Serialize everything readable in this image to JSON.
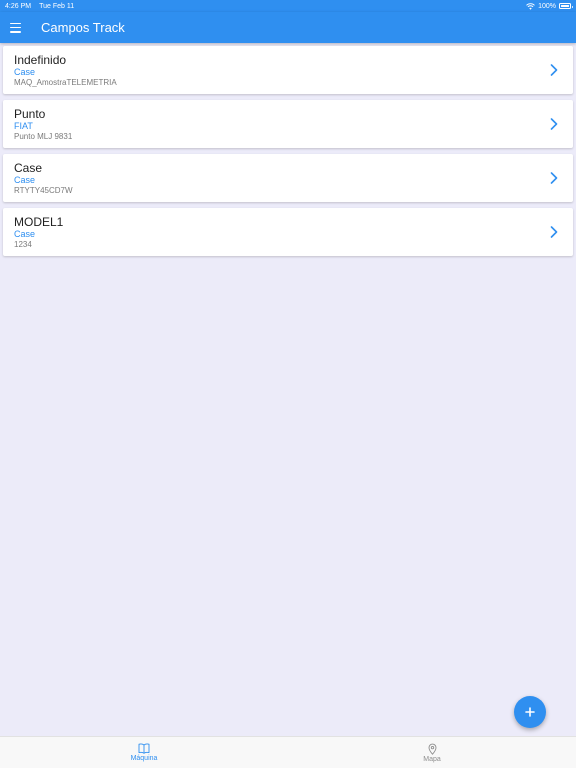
{
  "status_bar": {
    "time": "4:26 PM",
    "date": "Tue Feb 11",
    "battery": "100%",
    "icons": [
      "wifi-icon",
      "battery-icon"
    ]
  },
  "app_bar": {
    "title": "Campos Track",
    "menu_icon": "hamburger-menu-icon"
  },
  "machines": [
    {
      "name": "Indefinido",
      "brand": "Case",
      "model": "MAQ_AmostraTELEMETRIA"
    },
    {
      "name": "Punto",
      "brand": "FIAT",
      "model": "Punto MLJ 9831"
    },
    {
      "name": "Case",
      "brand": "Case",
      "model": "RTYTY45CD7W"
    },
    {
      "name": "MODEL1",
      "brand": "Case",
      "model": "1234"
    }
  ],
  "fab": {
    "icon": "plus-icon",
    "label": "+"
  },
  "tabs": [
    {
      "label": "Máquina",
      "icon": "book-icon",
      "active": true
    },
    {
      "label": "Mapa",
      "icon": "map-pin-icon",
      "active": false
    }
  ],
  "colors": {
    "primary": "#2f8ff0",
    "background": "#ecebf9"
  }
}
